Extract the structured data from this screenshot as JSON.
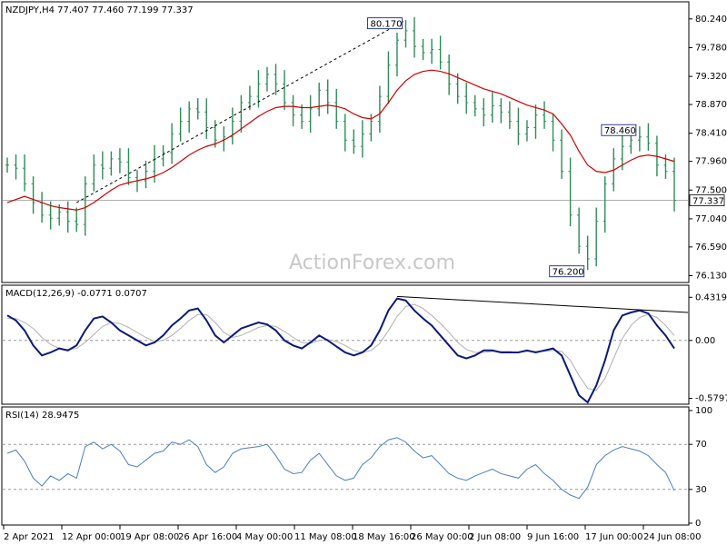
{
  "chart_data": [
    {
      "type": "line",
      "panel": "price",
      "title": "NZDJPY,H4  77.407 77.460 77.199 77.337",
      "y_ticks": [
        "80.240",
        "79.780",
        "79.320",
        "78.870",
        "78.410",
        "77.960",
        "77.500",
        "77.040",
        "76.590",
        "76.130"
      ],
      "ylim": [
        76.05,
        80.31
      ],
      "current_price": 77.337,
      "current_price_label": "77.337",
      "x_ticks": [
        "2 Apr 2021",
        "12 Apr 00:00",
        "19 Apr 08:00",
        "26 Apr 16:00",
        "4 May 00:00",
        "11 May 08:00",
        "18 May 16:00",
        "26 May 00:00",
        "2 Jun 08:00",
        "9 Jun 16:00",
        "17 Jun 00:00",
        "24 Jun 08:00"
      ],
      "annotations": [
        {
          "text": "80.170",
          "value": 80.17
        },
        {
          "text": "78.460",
          "value": 78.46
        },
        {
          "text": "76.200",
          "value": 76.2
        }
      ],
      "series": [
        {
          "name": "",
          "kind": "close",
          "values": [
            77.9,
            77.85,
            77.6,
            77.3,
            77.1,
            77.05,
            77.15,
            77.0,
            76.95,
            77.6,
            77.9,
            77.85,
            78.0,
            77.95,
            77.7,
            77.65,
            77.8,
            78.0,
            78.1,
            78.4,
            78.6,
            78.8,
            78.75,
            78.5,
            78.3,
            78.35,
            78.6,
            78.9,
            79.0,
            79.2,
            79.35,
            79.2,
            78.9,
            78.7,
            78.6,
            78.8,
            79.1,
            78.9,
            78.6,
            78.3,
            78.2,
            78.4,
            78.6,
            79.0,
            79.5,
            79.9,
            80.05,
            79.8,
            79.7,
            79.75,
            79.55,
            79.2,
            79.0,
            78.9,
            78.8,
            78.7,
            78.85,
            78.75,
            78.6,
            78.4,
            78.5,
            78.7,
            78.6,
            78.3,
            77.8,
            77.1,
            76.6,
            76.4,
            77.0,
            77.6,
            78.0,
            78.2,
            78.3,
            78.35,
            78.25,
            77.9,
            77.8,
            77.337
          ]
        },
        {
          "name": "",
          "kind": "moving-average",
          "values": [
            77.3,
            77.35,
            77.4,
            77.35,
            77.3,
            77.25,
            77.22,
            77.2,
            77.18,
            77.22,
            77.3,
            77.4,
            77.5,
            77.58,
            77.62,
            77.65,
            77.68,
            77.72,
            77.78,
            77.86,
            77.96,
            78.06,
            78.14,
            78.2,
            78.24,
            78.3,
            78.38,
            78.48,
            78.58,
            78.68,
            78.76,
            78.82,
            78.84,
            78.84,
            78.82,
            78.82,
            78.84,
            78.86,
            78.84,
            78.8,
            78.72,
            78.66,
            78.64,
            78.72,
            78.9,
            79.1,
            79.25,
            79.35,
            79.4,
            79.42,
            79.4,
            79.36,
            79.3,
            79.24,
            79.18,
            79.12,
            79.08,
            79.04,
            78.98,
            78.92,
            78.86,
            78.82,
            78.78,
            78.72,
            78.56,
            78.38,
            78.12,
            77.9,
            77.8,
            77.78,
            77.82,
            77.9,
            77.98,
            78.04,
            78.06,
            78.04,
            78.0,
            77.96
          ]
        }
      ]
    },
    {
      "type": "line",
      "panel": "macd",
      "title": "MACD(12,26,9) -0.0771 0.0707",
      "y_ticks": [
        "0.4319",
        "0.00",
        "-0.5797"
      ],
      "ylim": [
        -0.62,
        0.48
      ],
      "series": [
        {
          "name": "",
          "kind": "macd",
          "values": [
            0.25,
            0.2,
            0.1,
            -0.05,
            -0.15,
            -0.12,
            -0.08,
            -0.1,
            -0.05,
            0.1,
            0.22,
            0.24,
            0.18,
            0.1,
            0.05,
            0.0,
            -0.05,
            -0.02,
            0.05,
            0.15,
            0.22,
            0.3,
            0.32,
            0.2,
            0.05,
            -0.02,
            0.05,
            0.12,
            0.15,
            0.18,
            0.16,
            0.1,
            0.0,
            -0.05,
            -0.08,
            -0.02,
            0.05,
            0.0,
            -0.06,
            -0.12,
            -0.15,
            -0.12,
            -0.05,
            0.1,
            0.3,
            0.42,
            0.4,
            0.3,
            0.22,
            0.15,
            0.05,
            -0.05,
            -0.15,
            -0.18,
            -0.15,
            -0.1,
            -0.1,
            -0.12,
            -0.12,
            -0.12,
            -0.1,
            -0.12,
            -0.1,
            -0.08,
            -0.15,
            -0.35,
            -0.55,
            -0.62,
            -0.45,
            -0.2,
            0.1,
            0.25,
            0.28,
            0.3,
            0.27,
            0.15,
            0.05,
            -0.08
          ]
        },
        {
          "name": "",
          "kind": "signal",
          "values": [
            0.22,
            0.22,
            0.18,
            0.12,
            0.03,
            -0.04,
            -0.08,
            -0.09,
            -0.08,
            -0.02,
            0.06,
            0.14,
            0.18,
            0.17,
            0.13,
            0.08,
            0.03,
            -0.01,
            0.0,
            0.05,
            0.12,
            0.2,
            0.26,
            0.26,
            0.18,
            0.08,
            0.03,
            0.05,
            0.09,
            0.13,
            0.15,
            0.14,
            0.09,
            0.03,
            -0.02,
            -0.03,
            0.0,
            0.01,
            -0.01,
            -0.05,
            -0.1,
            -0.12,
            -0.1,
            -0.03,
            0.1,
            0.24,
            0.34,
            0.36,
            0.32,
            0.25,
            0.17,
            0.08,
            -0.02,
            -0.09,
            -0.12,
            -0.12,
            -0.11,
            -0.11,
            -0.11,
            -0.12,
            -0.11,
            -0.11,
            -0.11,
            -0.1,
            -0.11,
            -0.2,
            -0.35,
            -0.48,
            -0.5,
            -0.38,
            -0.18,
            0.02,
            0.15,
            0.23,
            0.26,
            0.23,
            0.15,
            0.05
          ]
        }
      ]
    },
    {
      "type": "line",
      "panel": "rsi",
      "title": "RSI(14) 28.9475",
      "y_ticks": [
        "100",
        "70",
        "30",
        "0"
      ],
      "ylim": [
        0,
        100
      ],
      "series": [
        {
          "name": "",
          "kind": "rsi",
          "values": [
            62,
            65,
            55,
            40,
            33,
            42,
            38,
            44,
            40,
            68,
            72,
            66,
            70,
            64,
            52,
            50,
            56,
            62,
            64,
            72,
            70,
            74,
            68,
            52,
            45,
            50,
            62,
            66,
            67,
            68,
            70,
            60,
            48,
            44,
            45,
            56,
            62,
            52,
            42,
            38,
            40,
            52,
            58,
            68,
            74,
            76,
            72,
            64,
            58,
            60,
            52,
            44,
            40,
            38,
            42,
            45,
            48,
            44,
            42,
            40,
            48,
            52,
            44,
            38,
            30,
            25,
            22,
            32,
            52,
            60,
            65,
            68,
            66,
            64,
            60,
            52,
            45,
            29
          ]
        }
      ]
    }
  ]
}
